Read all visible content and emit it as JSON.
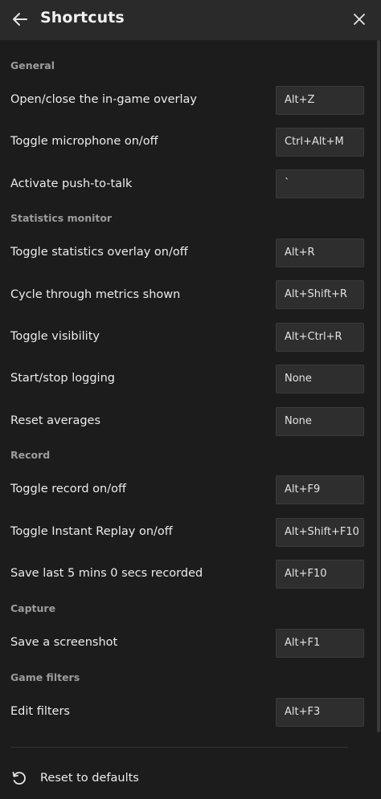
{
  "header": {
    "title": "Shortcuts"
  },
  "icons": {
    "back": "arrow-left-icon",
    "close": "close-icon",
    "reset": "refresh-icon"
  },
  "sections": [
    {
      "title": "General",
      "items": [
        {
          "label": "Open/close the in-game overlay",
          "key": "Alt+Z"
        },
        {
          "label": "Toggle microphone on/off",
          "key": "Ctrl+Alt+M"
        },
        {
          "label": "Activate push-to-talk",
          "key": "`"
        }
      ]
    },
    {
      "title": "Statistics monitor",
      "items": [
        {
          "label": "Toggle statistics overlay on/off",
          "key": "Alt+R"
        },
        {
          "label": "Cycle through metrics shown",
          "key": "Alt+Shift+R"
        },
        {
          "label": "Toggle visibility",
          "key": "Alt+Ctrl+R"
        },
        {
          "label": "Start/stop logging",
          "key": "None"
        },
        {
          "label": "Reset averages",
          "key": "None"
        }
      ]
    },
    {
      "title": "Record",
      "items": [
        {
          "label": "Toggle record on/off",
          "key": "Alt+F9"
        },
        {
          "label": "Toggle Instant Replay on/off",
          "key": "Alt+Shift+F10"
        },
        {
          "label": "Save last 5 mins 0 secs recorded",
          "key": "Alt+F10"
        }
      ]
    },
    {
      "title": "Capture",
      "items": [
        {
          "label": "Save a screenshot",
          "key": "Alt+F1"
        }
      ]
    },
    {
      "title": "Game filters",
      "items": [
        {
          "label": "Edit filters",
          "key": "Alt+F3"
        }
      ]
    }
  ],
  "footer": {
    "reset_label": "Reset to defaults"
  }
}
